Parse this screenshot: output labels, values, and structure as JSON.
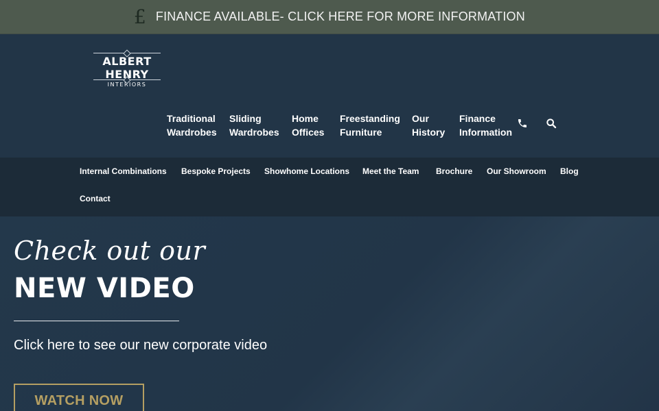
{
  "finance_bar": {
    "icon": "pound-sterling-icon",
    "symbol": "£",
    "text": "FINANCE AVAILABLE- CLICK HERE FOR MORE INFORMATION"
  },
  "logo": {
    "main": "ALBERT HENRY",
    "sub": "INTERIORS"
  },
  "main_nav": {
    "items": [
      {
        "line1": "Traditional",
        "line2": "Wardrobes"
      },
      {
        "line1": "Sliding",
        "line2": "Wardrobes"
      },
      {
        "line1": "Home",
        "line2": "Offices"
      },
      {
        "line1": "Freestanding",
        "line2": "Furniture"
      },
      {
        "line1": "Our",
        "line2": "History"
      },
      {
        "line1": "Finance",
        "line2": "Information"
      }
    ],
    "phone_icon": "phone-icon",
    "search_icon": "search-icon"
  },
  "sub_nav": {
    "items": [
      "Internal Combinations",
      "Bespoke Projects",
      "Showhome Locations",
      "Meet the Team",
      "Brochure",
      "Our Showroom",
      "Blog",
      "Contact"
    ]
  },
  "hero": {
    "script_heading": "Check out our",
    "title": "NEW VIDEO",
    "description": "Click here to see our new corporate video",
    "button": "WATCH NOW"
  },
  "colors": {
    "finance_bar": "#4e5a4e",
    "header": "#223547",
    "sub_nav": "#1c2b38",
    "accent_gold": "#b59f62"
  }
}
